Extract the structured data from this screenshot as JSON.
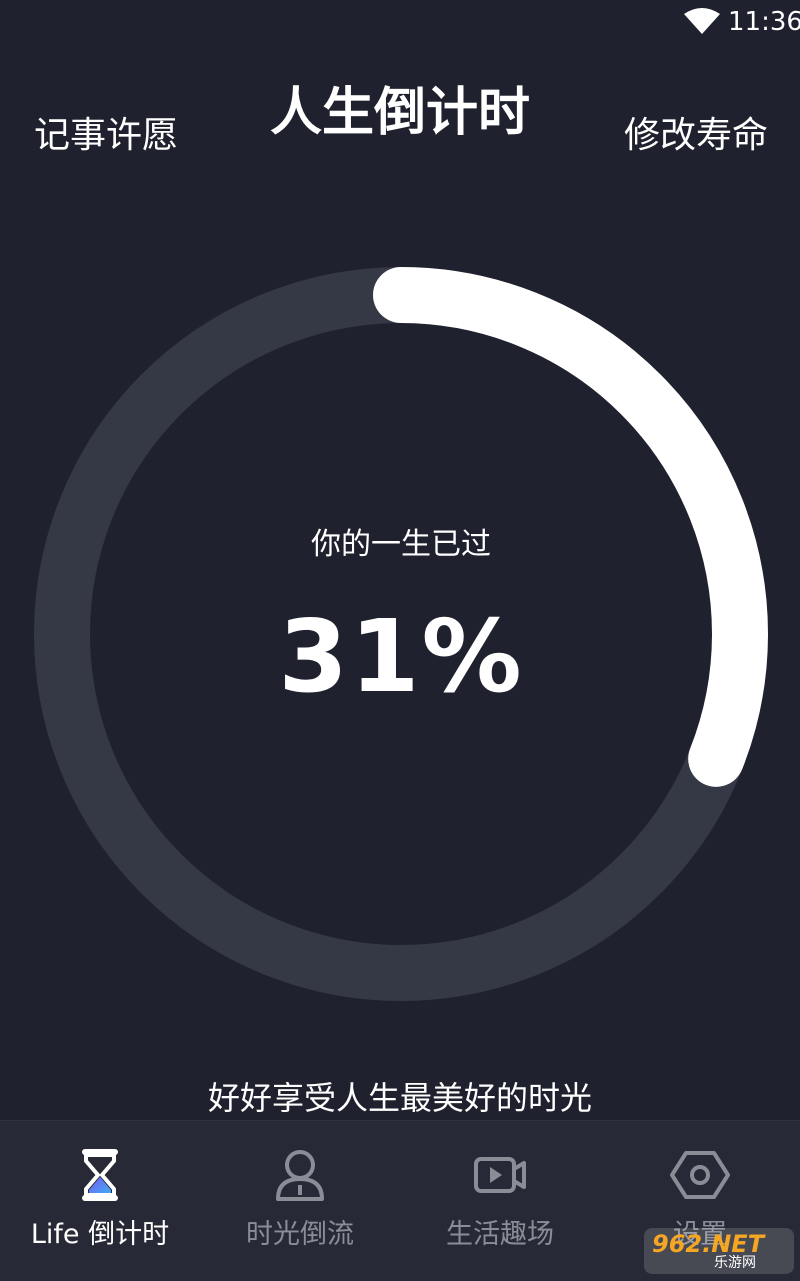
{
  "status_bar": {
    "time": "11:36"
  },
  "header": {
    "left_action": "记事许愿",
    "title": "人生倒计时",
    "right_action": "修改寿命"
  },
  "progress": {
    "label": "你的一生已过",
    "percent_text": "31%",
    "fraction": 0.31,
    "track_color": "#353945",
    "fill_color": "#ffffff"
  },
  "motto": "好好享受人生最美好的时光",
  "bottom_nav": {
    "items": [
      {
        "label": "Life 倒计时",
        "icon": "hourglass-icon",
        "active": true
      },
      {
        "label": "时光倒流",
        "icon": "person-icon",
        "active": false
      },
      {
        "label": "生活趣场",
        "icon": "video-play-icon",
        "active": false
      },
      {
        "label": "设置",
        "icon": "hexagon-settings-icon",
        "active": false
      }
    ]
  },
  "watermark": {
    "main": "962.NET",
    "sub": "乐游网"
  },
  "colors": {
    "background": "#1f222e",
    "nav_background": "#272a36",
    "inactive": "#8a8d96",
    "accent_purple": "#7b5cf0",
    "accent_blue": "#3fa9f5"
  }
}
